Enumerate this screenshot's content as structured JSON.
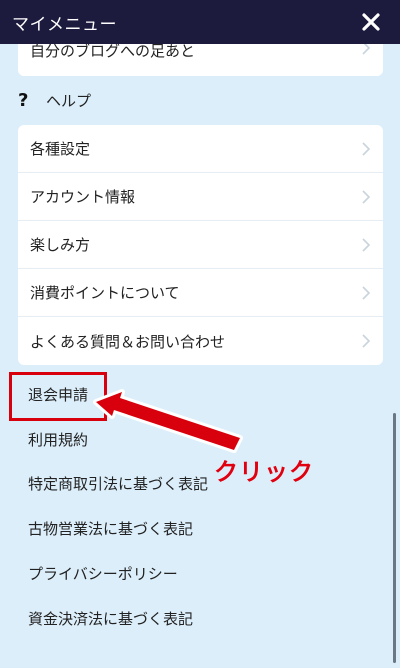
{
  "header": {
    "title": "マイメニュー",
    "close_icon": "close-icon"
  },
  "top_card": {
    "items": [
      {
        "label": "自分のブログへの足あと"
      }
    ]
  },
  "help_section": {
    "icon": "question-icon",
    "icon_glyph": "?",
    "title": "ヘルプ"
  },
  "help_card": {
    "items": [
      {
        "label": "各種設定"
      },
      {
        "label": "アカウント情報"
      },
      {
        "label": "楽しみ方"
      },
      {
        "label": "消費ポイントについて"
      },
      {
        "label": "よくある質問＆お問い合わせ"
      }
    ]
  },
  "plain_links": [
    {
      "label": "退会申請"
    },
    {
      "label": "利用規約"
    },
    {
      "label": "特定商取引法に基づく表記"
    },
    {
      "label": "古物営業法に基づく表記"
    },
    {
      "label": "プライバシーポリシー"
    },
    {
      "label": "資金決済法に基づく表記"
    }
  ],
  "annotation": {
    "label": "クリック",
    "color": "#e0000f"
  },
  "colors": {
    "header_bg": "#1c1a3d",
    "page_bg": "#dceefa",
    "annotation_red": "#d8000c"
  }
}
